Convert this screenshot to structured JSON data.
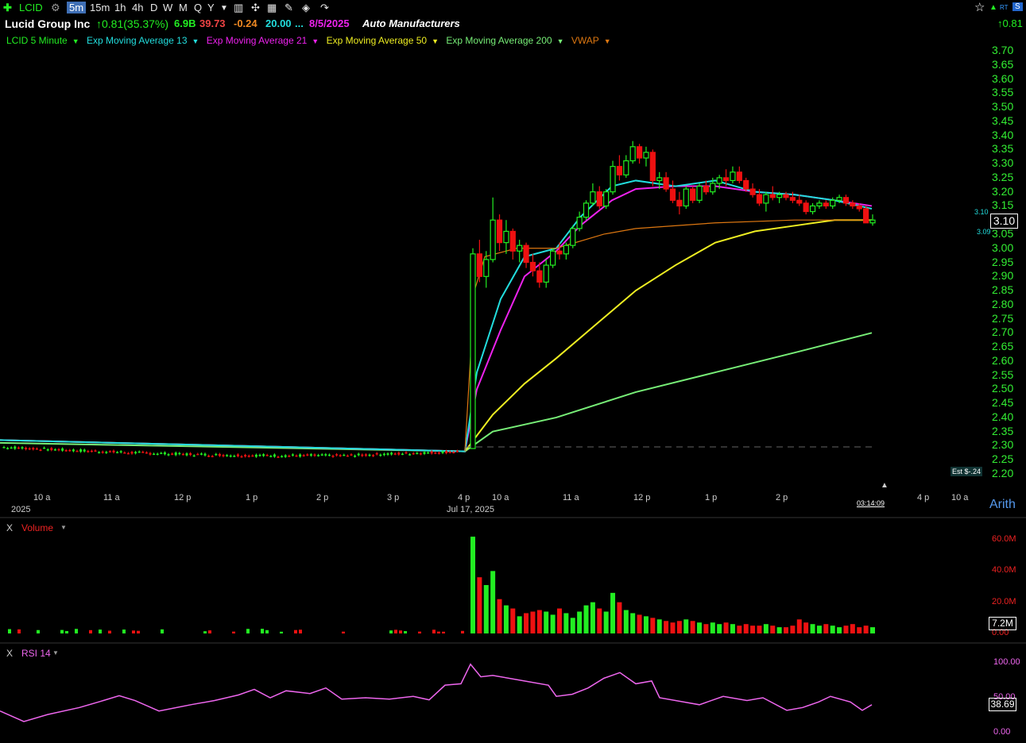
{
  "toolbar": {
    "symbol": "LCID",
    "timeframes": [
      "5m",
      "15m",
      "1h",
      "4h",
      "D",
      "W",
      "M",
      "Q",
      "Y"
    ],
    "selected": "5m",
    "right_change": "↑0.81",
    "rt_label": "RT",
    "s_label": "S"
  },
  "header": {
    "company": "Lucid Group Inc",
    "change": "↑0.81(35.37%)",
    "mcap": "6.9B",
    "v1": "39.73",
    "v2": "-0.24",
    "v3": "20.00",
    "ellipsis": "...",
    "date": "8/5/2025",
    "industry": "Auto Manufacturers"
  },
  "studies": {
    "main": "LCID 5 Minute",
    "ema13": "Exp Moving Average 13",
    "ema21": "Exp Moving Average 21",
    "ema50": "Exp Moving Average 50",
    "ema200": "Exp Moving Average 200",
    "vwap": "VWAP"
  },
  "price_axis": {
    "ticks": [
      "3.70",
      "3.65",
      "3.60",
      "3.55",
      "3.50",
      "3.45",
      "3.40",
      "3.35",
      "3.30",
      "3.25",
      "3.20",
      "3.15",
      "3.10",
      "3.05",
      "3.00",
      "2.95",
      "2.90",
      "2.85",
      "2.80",
      "2.75",
      "2.70",
      "2.65",
      "2.60",
      "2.55",
      "2.50",
      "2.45",
      "2.40",
      "2.35",
      "2.30",
      "2.25",
      "2.20"
    ],
    "last_price": "3.10",
    "bid": "3.10",
    "ask": "3.09",
    "est": "Est $-.24",
    "scale": "Arith"
  },
  "time_axis": {
    "labels": [
      "10 a",
      "11 a",
      "12 p",
      "1 p",
      "2 p",
      "3 p",
      "4 p",
      "10 a",
      "11 a",
      "12 p",
      "1 p",
      "2 p",
      "4 p",
      "10 a"
    ],
    "date_left": "2025",
    "date_mid": "Jul 17, 2025",
    "countdown": "03:14:09"
  },
  "volume_panel": {
    "title": "Volume",
    "close": "X",
    "ticks": [
      "60.0M",
      "40.0M",
      "20.0M",
      "0.00"
    ],
    "current": "7.2M"
  },
  "rsi_panel": {
    "title": "RSI 14",
    "close": "X",
    "ticks": [
      "100.00",
      "50.00",
      "0.00"
    ],
    "current": "38.69"
  },
  "colors": {
    "up": "#22ee22",
    "down": "#ee1111",
    "ema13": "#22dddd",
    "ema21": "#ee22ee",
    "ema50": "#eeee22",
    "ema200": "#77ee77",
    "vwap": "#dd7711",
    "rsi": "#ee66ee"
  },
  "chart_data": {
    "type": "candlestick",
    "ylim": [
      2.2,
      3.7
    ],
    "grid": false,
    "session2_ohlc": [
      [
        2.29,
        3.0,
        2.85,
        2.98
      ],
      [
        2.98,
        3.03,
        2.88,
        2.9
      ],
      [
        2.9,
        2.99,
        2.86,
        2.96
      ],
      [
        2.96,
        3.18,
        2.95,
        3.1
      ],
      [
        3.1,
        3.12,
        2.99,
        3.02
      ],
      [
        3.02,
        3.1,
        2.98,
        3.06
      ],
      [
        3.06,
        3.07,
        2.96,
        2.99
      ],
      [
        2.99,
        3.03,
        2.95,
        3.01
      ],
      [
        3.01,
        3.02,
        2.93,
        2.95
      ],
      [
        2.95,
        2.98,
        2.9,
        2.92
      ],
      [
        2.92,
        2.95,
        2.86,
        2.88
      ],
      [
        2.88,
        2.96,
        2.86,
        2.94
      ],
      [
        2.94,
        3.0,
        2.93,
        2.99
      ],
      [
        2.99,
        3.02,
        2.96,
        2.98
      ],
      [
        2.98,
        3.02,
        2.96,
        3.01
      ],
      [
        3.01,
        3.08,
        3.0,
        3.07
      ],
      [
        3.07,
        3.13,
        3.06,
        3.11
      ],
      [
        3.11,
        3.17,
        3.1,
        3.16
      ],
      [
        3.16,
        3.23,
        3.15,
        3.2
      ],
      [
        3.2,
        3.22,
        3.14,
        3.15
      ],
      [
        3.15,
        3.21,
        3.14,
        3.2
      ],
      [
        3.2,
        3.31,
        3.19,
        3.29
      ],
      [
        3.29,
        3.33,
        3.24,
        3.26
      ],
      [
        3.26,
        3.33,
        3.25,
        3.31
      ],
      [
        3.31,
        3.38,
        3.3,
        3.36
      ],
      [
        3.36,
        3.37,
        3.3,
        3.32
      ],
      [
        3.32,
        3.36,
        3.29,
        3.34
      ],
      [
        3.34,
        3.35,
        3.22,
        3.24
      ],
      [
        3.24,
        3.27,
        3.21,
        3.25
      ],
      [
        3.25,
        3.27,
        3.2,
        3.21
      ],
      [
        3.21,
        3.24,
        3.16,
        3.17
      ],
      [
        3.17,
        3.2,
        3.12,
        3.15
      ],
      [
        3.15,
        3.22,
        3.14,
        3.21
      ],
      [
        3.21,
        3.22,
        3.16,
        3.17
      ],
      [
        3.17,
        3.23,
        3.16,
        3.22
      ],
      [
        3.22,
        3.24,
        3.19,
        3.2
      ],
      [
        3.2,
        3.25,
        3.19,
        3.23
      ],
      [
        3.23,
        3.26,
        3.21,
        3.25
      ],
      [
        3.25,
        3.28,
        3.22,
        3.24
      ],
      [
        3.24,
        3.29,
        3.23,
        3.27
      ],
      [
        3.27,
        3.29,
        3.23,
        3.24
      ],
      [
        3.24,
        3.25,
        3.2,
        3.21
      ],
      [
        3.21,
        3.23,
        3.18,
        3.19
      ],
      [
        3.19,
        3.21,
        3.15,
        3.16
      ],
      [
        3.16,
        3.2,
        3.13,
        3.19
      ],
      [
        3.19,
        3.22,
        3.17,
        3.18
      ],
      [
        3.18,
        3.2,
        3.16,
        3.19
      ],
      [
        3.19,
        3.2,
        3.17,
        3.18
      ],
      [
        3.18,
        3.2,
        3.16,
        3.17
      ],
      [
        3.17,
        3.19,
        3.15,
        3.16
      ],
      [
        3.16,
        3.17,
        3.12,
        3.13
      ],
      [
        3.13,
        3.16,
        3.12,
        3.15
      ],
      [
        3.15,
        3.17,
        3.14,
        3.16
      ],
      [
        3.16,
        3.17,
        3.14,
        3.15
      ],
      [
        3.15,
        3.18,
        3.14,
        3.17
      ],
      [
        3.17,
        3.19,
        3.16,
        3.18
      ],
      [
        3.18,
        3.19,
        3.15,
        3.16
      ],
      [
        3.16,
        3.17,
        3.14,
        3.15
      ],
      [
        3.15,
        3.16,
        3.13,
        3.14
      ],
      [
        3.14,
        3.15,
        3.09,
        3.09
      ],
      [
        3.09,
        3.12,
        3.08,
        3.1
      ]
    ],
    "volume_ticks": [
      60,
      40,
      20,
      0
    ],
    "rsi_ticks": [
      100,
      50,
      0
    ]
  }
}
